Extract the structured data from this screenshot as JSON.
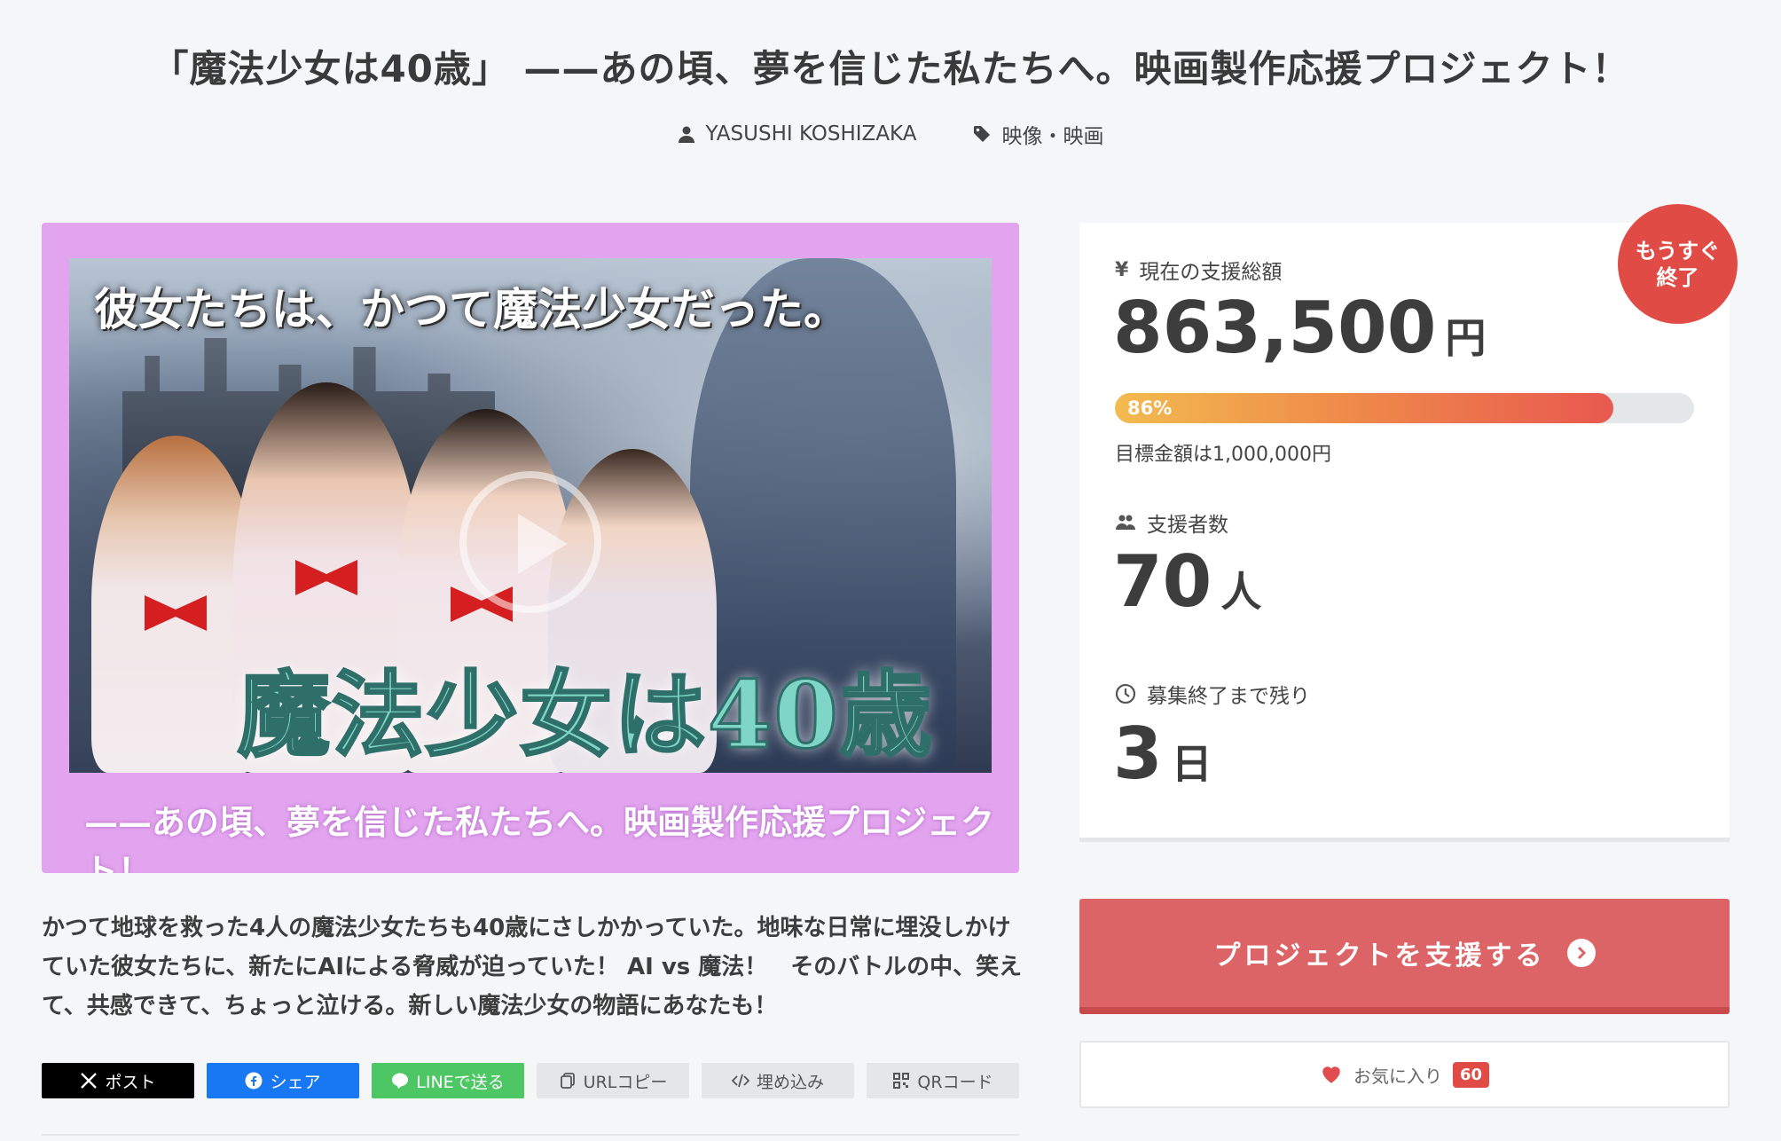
{
  "header": {
    "title": "「魔法少女は40歳」 ——あの頃、夢を信じた私たちへ。映画製作応援プロジェクト！",
    "author": "YASUSHI KOSHIZAKA",
    "category": "映像・映画",
    "author_icon": "user-icon",
    "category_icon": "tag-icon"
  },
  "hero": {
    "tagline": "彼女たちは、かつて魔法少女だった。",
    "logo_text": "魔法少女は40歳",
    "subtitle": "——あの頃、夢を信じた私たちへ。映画製作応援プロジェクト！",
    "play_icon": "play-icon"
  },
  "description": "かつて地球を救った4人の魔法少女たちも40歳にさしかかっていた。地味な日常に埋没しかけていた彼女たちに、新たにAIによる脅威が迫っていた！ AI vs 魔法！　そのバトルの中、笑えて、共感できて、ちょっと泣ける。新しい魔法少女の物語にあなたも！",
  "share": {
    "x_label": "ポスト",
    "facebook_label": "シェア",
    "line_label": "LINEで送る",
    "url_label": "URLコピー",
    "embed_label": "埋め込み",
    "qr_label": "QRコード"
  },
  "stats": {
    "amount_label": "現在の支援総額",
    "amount_value": "863,500",
    "amount_unit": "円",
    "progress_percent": 86,
    "progress_label": "86%",
    "goal_text": "目標金額は1,000,000円",
    "supporters_label": "支援者数",
    "supporters_value": "70",
    "supporters_unit": "人",
    "remaining_label": "募集終了まで残り",
    "remaining_value": "3",
    "remaining_unit": "日"
  },
  "badge": {
    "line1": "もうすぐ",
    "line2": "終了"
  },
  "actions": {
    "support_label": "プロジェクトを支援する",
    "favorite_label": "お気に入り",
    "favorite_count": "60"
  },
  "colors": {
    "accent": "#dc6466",
    "badge": "#e04c45",
    "progress_start": "#f2bb4f",
    "progress_end": "#e8594f",
    "hero_frame": "#e2a4ee"
  }
}
